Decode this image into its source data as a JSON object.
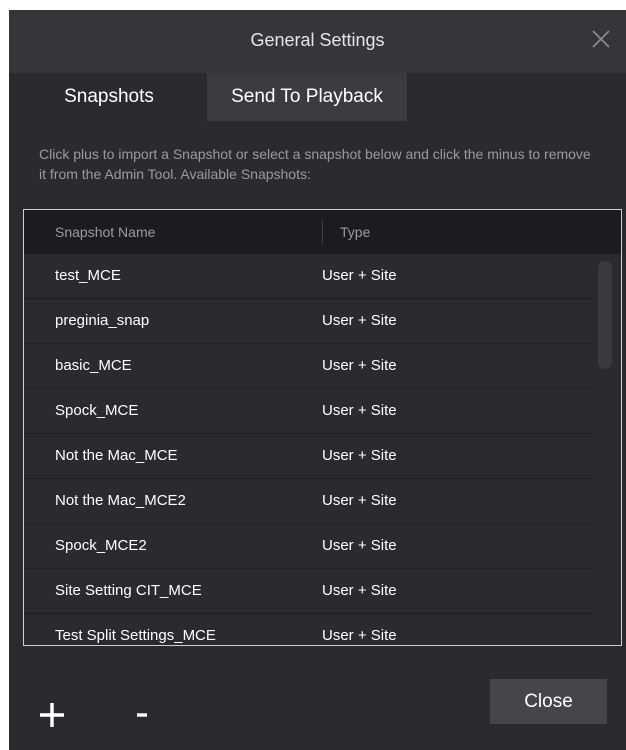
{
  "dialog": {
    "title": "General Settings",
    "close_icon": "close-icon"
  },
  "tabs": [
    {
      "label": "Snapshots",
      "active": true
    },
    {
      "label": "Send To Playback",
      "active": false
    }
  ],
  "instructions": "Click plus to import a Snapshot or select a snapshot below and click the minus to remove it from the Admin Tool. Available Snapshots:",
  "table": {
    "columns": [
      "Snapshot Name",
      "Type"
    ],
    "rows": [
      {
        "name": "test_MCE",
        "type": "User + Site"
      },
      {
        "name": "preginia_snap",
        "type": "User + Site"
      },
      {
        "name": "basic_MCE",
        "type": "User + Site"
      },
      {
        "name": "Spock_MCE",
        "type": "User + Site"
      },
      {
        "name": "Not the Mac_MCE",
        "type": "User + Site"
      },
      {
        "name": "Not the Mac_MCE2",
        "type": "User + Site"
      },
      {
        "name": "Spock_MCE2",
        "type": "User + Site"
      },
      {
        "name": "Site Setting CIT_MCE",
        "type": "User + Site"
      },
      {
        "name": "Test Split Settings_MCE",
        "type": "User + Site"
      }
    ]
  },
  "footer": {
    "add_icon": "plus-icon",
    "remove_icon": "minus-icon",
    "close_label": "Close"
  },
  "colors": {
    "dialog_bg": "#2a2b2f",
    "titlebar_bg": "#35363a",
    "header_bg": "#1b1c1f",
    "button_bg": "#45464b",
    "muted_text": "#9a9ba0"
  }
}
